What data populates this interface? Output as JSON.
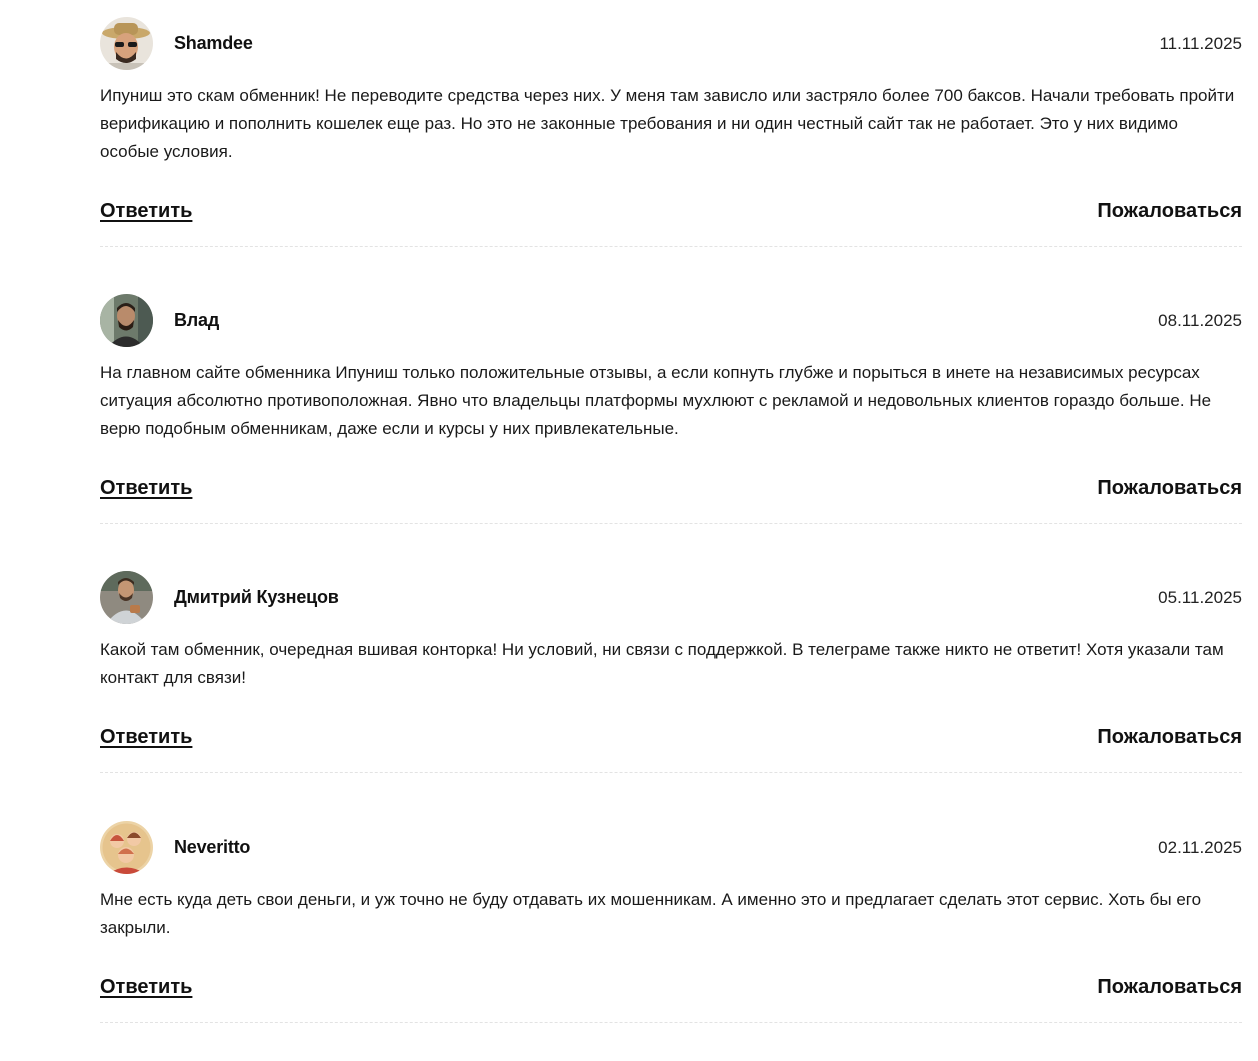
{
  "comments": [
    {
      "author": "Shamdee",
      "date": "11.11.2025",
      "text": "Ипуниш это скам обменник! Не переводите средства через них. У меня там зависло или застряло более 700 баксов. Начали требовать пройти верификацию и пополнить кошелек еще раз. Но это не законные требования и ни один честный сайт так не работает. Это у них видимо особые условия.",
      "reply_label": "Ответить",
      "report_label": "Пожаловаться"
    },
    {
      "author": "Влад",
      "date": "08.11.2025",
      "text": "На главном сайте обменника Ипуниш только положительные отзывы, а если копнуть глубже и порыться в инете на независимых ресурсах ситуация абсолютно противоположная. Явно что владельцы платформы мухлюют с рекламой и недовольных клиентов гораздо больше. Не верю подобным обменникам, даже если и курсы у них привлекательные.",
      "reply_label": "Ответить",
      "report_label": "Пожаловаться"
    },
    {
      "author": "Дмитрий Кузнецов",
      "date": "05.11.2025",
      "text": "Какой там обменник, очередная вшивая конторка! Ни условий, ни связи с поддержкой. В телеграме также никто не ответит! Хотя указали там контакт для связи!",
      "reply_label": "Ответить",
      "report_label": "Пожаловаться"
    },
    {
      "author": "Neveritto",
      "date": "02.11.2025",
      "text": "Мне есть куда деть свои деньги, и уж точно не буду отдавать их мошенникам. А именно это и предлагает сделать этот сервис. Хоть бы его закрыли.",
      "reply_label": "Ответить",
      "report_label": "Пожаловаться"
    }
  ]
}
